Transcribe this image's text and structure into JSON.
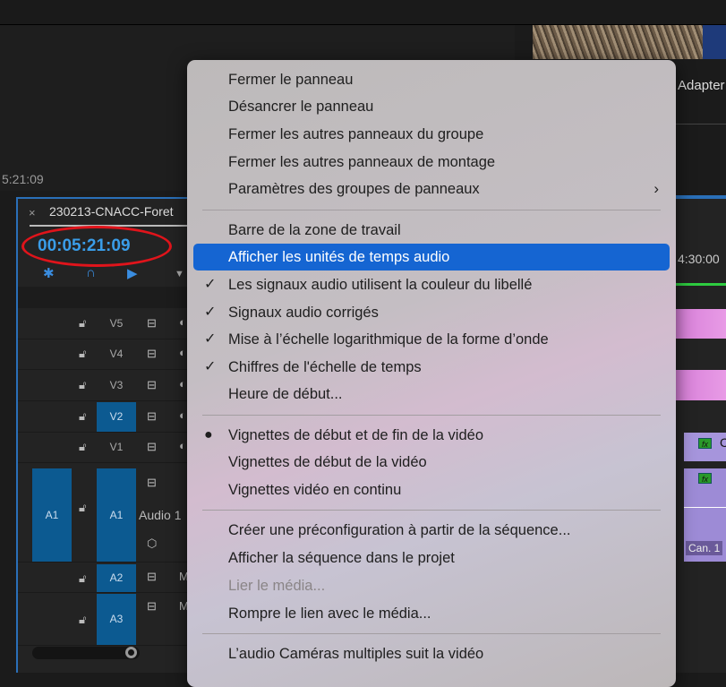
{
  "program": {
    "timecode": "5:21:09"
  },
  "timeline": {
    "tab_close": "×",
    "title": "230213-CNACC-Foret",
    "timecode": "00:05:21:09",
    "video_tracks": [
      {
        "label": "V5",
        "selected": false
      },
      {
        "label": "V4",
        "selected": false
      },
      {
        "label": "V3",
        "selected": false
      },
      {
        "label": "V2",
        "selected": true
      },
      {
        "label": "V1",
        "selected": false
      }
    ],
    "audio_tracks": [
      {
        "label": "A2"
      },
      {
        "label": "A3"
      }
    ],
    "a1": {
      "source": "A1",
      "target": "A1",
      "name": "Audio 1"
    },
    "right": {
      "fit_label": "Adapter",
      "ruler_time": "4:30:00",
      "clip_fx": "fx",
      "channel_label": "Can. 1",
      "clip_initial": "C"
    }
  },
  "menu": {
    "items": [
      {
        "label": "Fermer le panneau"
      },
      {
        "label": "Désancrer le panneau"
      },
      {
        "label": "Fermer les autres panneaux du groupe"
      },
      {
        "label": "Fermer les autres panneaux de montage"
      },
      {
        "label": "Paramètres des groupes de panneaux",
        "submenu": "›"
      },
      {
        "label": "Barre de la zone de travail"
      },
      {
        "label": "Afficher les unités de temps audio",
        "highlighted": true
      },
      {
        "label": "Les signaux audio utilisent la couleur du libellé",
        "mark": "✓"
      },
      {
        "label": "Signaux audio corrigés",
        "mark": "✓"
      },
      {
        "label": "Mise à l’échelle logarithmique de la forme d’onde",
        "mark": "✓"
      },
      {
        "label": "Chiffres de l'échelle de temps",
        "mark": "✓"
      },
      {
        "label": "Heure de début..."
      },
      {
        "label": "Vignettes de début et de fin de la vidéo",
        "mark": "●"
      },
      {
        "label": "Vignettes de début de la vidéo"
      },
      {
        "label": "Vignettes vidéo en continu"
      },
      {
        "label": "Créer une préconfiguration à partir de la séquence..."
      },
      {
        "label": "Afficher la séquence dans le projet"
      },
      {
        "label": "Lier le média...",
        "disabled": true
      },
      {
        "label": "Rompre le lien avec le média..."
      },
      {
        "label": "L’audio Caméras multiples suit la vidéo"
      }
    ]
  },
  "colors": {
    "accent": "#1565d2",
    "timecode": "#3a9de8",
    "annotation": "#e0141b",
    "track_selected": "#0c5a91"
  }
}
